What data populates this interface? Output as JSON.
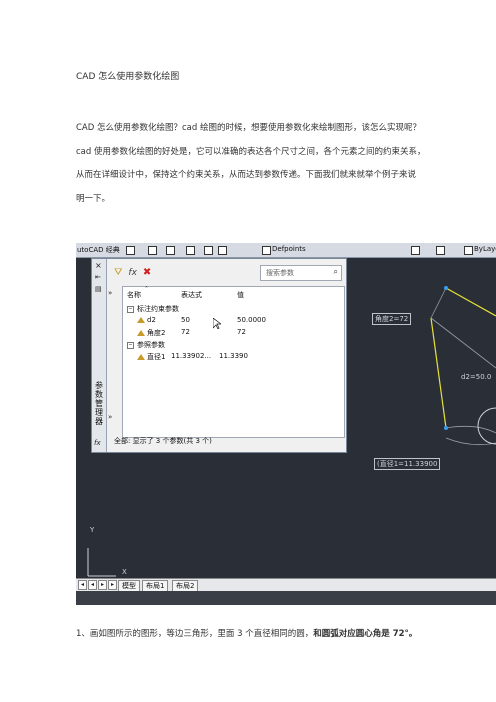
{
  "doc": {
    "title": "CAD 怎么使用参数化绘图",
    "paragraph_lines": [
      "CAD 怎么使用参数化绘图？cad 绘图的时候，想要使用参数化来绘制图形，该怎么实现呢？",
      "cad 使用参数化绘图的好处是，它可以准确的表达各个尺寸之间，各个元素之间的约束关系，",
      "从而在详细设计中，保持这个约束关系，从而达到参数传递。下面我们就来就举个例子来说",
      "明一下。"
    ],
    "caption_prefix": "1、画如图所示的图形，等边三角形，里面 3 个直径相同的圆，",
    "caption_bold": "和圆弧对应圆心角是 72°。"
  },
  "app": {
    "title_fragment": "utoCAD 经典",
    "layer_name": "Defpoints",
    "right_item": "ByLaye",
    "tabs": [
      "模型",
      "布局1",
      "布局2"
    ]
  },
  "palette": {
    "vertical_title": "参数管理器",
    "search_placeholder": "搜索参数",
    "columns": {
      "name": "名称",
      "expression": "表达式",
      "value": "值"
    },
    "groups": [
      {
        "label": "标注约束参数",
        "rows": [
          {
            "name": "d2",
            "expression": "50",
            "value": "50.0000"
          },
          {
            "name": "角度2",
            "expression": "72",
            "value": "72"
          }
        ]
      },
      {
        "label": "参照参数",
        "rows": [
          {
            "name": "直径1",
            "expression": "11.33902...",
            "value": "11.3390"
          }
        ]
      }
    ],
    "status": "全部: 显示了 3 个参数(共 3 个)"
  },
  "drawing": {
    "angle_label": "角度2=72",
    "length_label": "d2=50.0",
    "diameter_label": "(直径1=11.33900",
    "y_axis": "Y",
    "x_axis": "X"
  },
  "colors": {
    "canvas": "#2a2e36",
    "triangle": "#e6e23a",
    "arc_guide": "#6b7078"
  }
}
